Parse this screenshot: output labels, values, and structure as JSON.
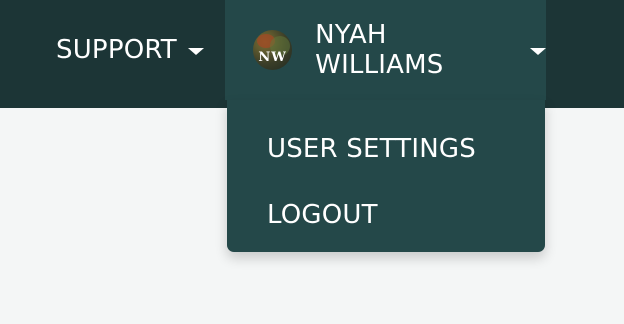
{
  "nav": {
    "support_label": "SUPPORT",
    "user_name": "NYAH WILLIAMS",
    "avatar_initials": "NW"
  },
  "dropdown": {
    "items": [
      {
        "label": "USER SETTINGS"
      },
      {
        "label": "LOGOUT"
      }
    ]
  },
  "colors": {
    "topbar": "#1c3536",
    "menu_background": "#244849",
    "page_background": "#f4f6f6",
    "text": "#ffffff"
  },
  "icons": {
    "support_caret": "chevron-down-icon",
    "user_caret": "chevron-down-icon"
  }
}
